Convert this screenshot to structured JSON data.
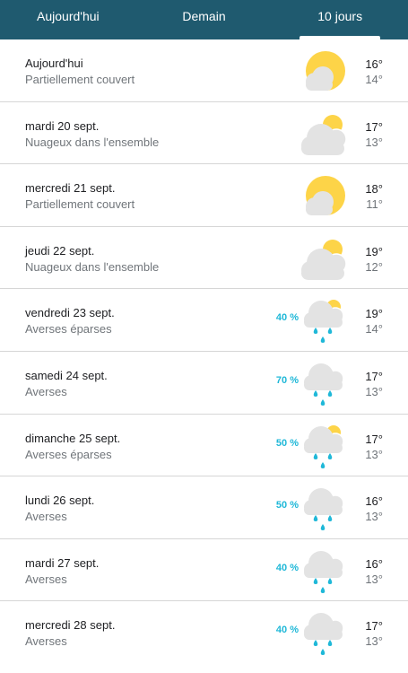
{
  "tabs": [
    {
      "label": "Aujourd'hui",
      "active": false
    },
    {
      "label": "Demain",
      "active": false
    },
    {
      "label": "10 jours",
      "active": true
    }
  ],
  "forecast": [
    {
      "day": "Aujourd'hui",
      "condition": "Partiellement couvert",
      "icon": "sun-behind-cloud-icon",
      "precip": "",
      "high": "16°",
      "low": "14°"
    },
    {
      "day": "mardi 20 sept.",
      "condition": "Nuageux dans l'ensemble",
      "icon": "mostly-cloudy-icon",
      "precip": "",
      "high": "17°",
      "low": "13°"
    },
    {
      "day": "mercredi 21 sept.",
      "condition": "Partiellement couvert",
      "icon": "sun-behind-cloud-icon",
      "precip": "",
      "high": "18°",
      "low": "11°"
    },
    {
      "day": "jeudi 22 sept.",
      "condition": "Nuageux dans l'ensemble",
      "icon": "mostly-cloudy-icon",
      "precip": "",
      "high": "19°",
      "low": "12°"
    },
    {
      "day": "vendredi 23 sept.",
      "condition": "Averses éparses",
      "icon": "scattered-showers-icon",
      "precip": "40 %",
      "high": "19°",
      "low": "14°"
    },
    {
      "day": "samedi 24 sept.",
      "condition": "Averses",
      "icon": "showers-icon",
      "precip": "70 %",
      "high": "17°",
      "low": "13°"
    },
    {
      "day": "dimanche 25 sept.",
      "condition": "Averses éparses",
      "icon": "scattered-showers-icon",
      "precip": "50 %",
      "high": "17°",
      "low": "13°"
    },
    {
      "day": "lundi 26 sept.",
      "condition": "Averses",
      "icon": "showers-icon",
      "precip": "50 %",
      "high": "16°",
      "low": "13°"
    },
    {
      "day": "mardi 27 sept.",
      "condition": "Averses",
      "icon": "showers-icon",
      "precip": "40 %",
      "high": "16°",
      "low": "13°"
    },
    {
      "day": "mercredi 28 sept.",
      "condition": "Averses",
      "icon": "showers-icon",
      "precip": "40 %",
      "high": "17°",
      "low": "13°"
    }
  ],
  "colors": {
    "tab_bar": "#1f5a6f",
    "sun": "#fdd448",
    "cloud": "#e3e3e3",
    "rain": "#1fb8d8",
    "precip_text": "#1fb8d8"
  }
}
